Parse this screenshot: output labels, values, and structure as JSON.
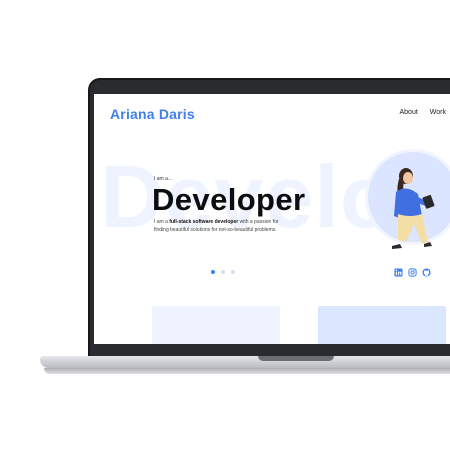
{
  "site": {
    "brand": "Ariana Daris",
    "nav": [
      "About",
      "Work"
    ],
    "background_word": "Develo",
    "eyebrow": "I am a...",
    "headline": "Developer",
    "intro_prefix": "I am a ",
    "intro_bold": "full-stack software developer",
    "intro_suffix": " with a passion for finding beautiful solutions for not-so-beautiful problems.",
    "carousel": {
      "count": 3,
      "active_index": 0
    },
    "socials": [
      "linkedin-icon",
      "instagram-icon",
      "github-icon"
    ]
  },
  "colors": {
    "accent": "#3f7ff0",
    "background_word": "#eef3ff",
    "card_light": "#eef3ff",
    "card_blue": "#dbe6ff",
    "illustration_shirt": "#3f6fe0",
    "illustration_pants": "#f3dfa5"
  }
}
